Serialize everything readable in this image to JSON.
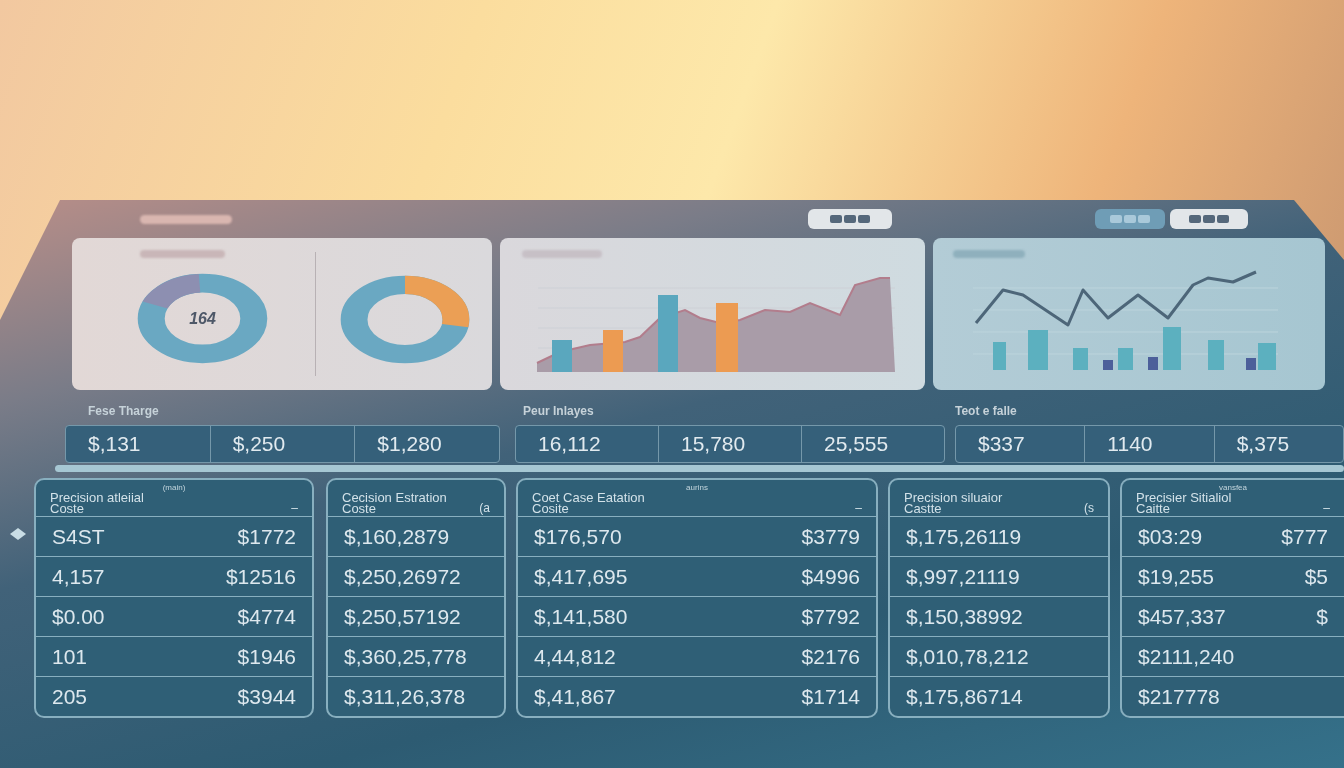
{
  "dashboard": {
    "toolbar_buttons": [
      {
        "selected": false
      },
      {
        "selected": true
      },
      {
        "selected": false
      }
    ],
    "chart_cards": [
      {
        "kind": "donuts",
        "center_value": "164"
      },
      {
        "kind": "bar_area"
      },
      {
        "kind": "line_bar"
      }
    ],
    "summary_groups": [
      {
        "label": "Fese Tharge",
        "values": [
          "$,131",
          "$,250",
          "$1,280"
        ]
      },
      {
        "label": "Peur Inlayes",
        "values": [
          "16,112",
          "15,780",
          "25,555"
        ]
      },
      {
        "label": "Teot e falle",
        "values": [
          "$337",
          "1140",
          "$,375"
        ]
      }
    ],
    "tables": [
      {
        "note": "(main)",
        "title": "Precision atleiial",
        "subtitle": "Coste",
        "corner": "–",
        "rows": [
          [
            "S4ST",
            "$1772"
          ],
          [
            "4,157",
            "$12516"
          ],
          [
            "$0.00",
            "$4774"
          ],
          [
            "101",
            "$1946"
          ],
          [
            "205",
            "$3944"
          ]
        ]
      },
      {
        "title": "Cecision Estration",
        "subtitle": "Coste",
        "corner": "(a",
        "rows": [
          [
            "$,160,2879"
          ],
          [
            "$,250,26972"
          ],
          [
            "$,250,57192"
          ],
          [
            "$,360,25,778"
          ],
          [
            "$,311,26,378"
          ]
        ]
      },
      {
        "note": "aurins",
        "title": "Coet Case Eatation",
        "subtitle": "Cosite",
        "corner": "–",
        "rows": [
          [
            "$176,570",
            "$3779"
          ],
          [
            "$,417,695",
            "$4996"
          ],
          [
            "$,141,580",
            "$7792"
          ],
          [
            "4,44,812",
            "$2176"
          ],
          [
            "$,41,867",
            "$1714"
          ]
        ]
      },
      {
        "title": "Precision siluaior",
        "subtitle": "Castte",
        "corner": "(s",
        "rows": [
          [
            "$,175,26119"
          ],
          [
            "$,997,21119"
          ],
          [
            "$,150,38992"
          ],
          [
            "$,010,78,212"
          ],
          [
            "$,175,86714"
          ]
        ]
      },
      {
        "note": "vansfea",
        "title": "Precisier Sitialiol",
        "subtitle": "Caitte",
        "corner": "–",
        "rows": [
          [
            "$03:29",
            "$777"
          ],
          [
            "$19,255",
            "$5"
          ],
          [
            "$457,337",
            "$"
          ],
          [
            "$2111,240"
          ],
          [
            "$217778"
          ]
        ]
      }
    ]
  }
}
